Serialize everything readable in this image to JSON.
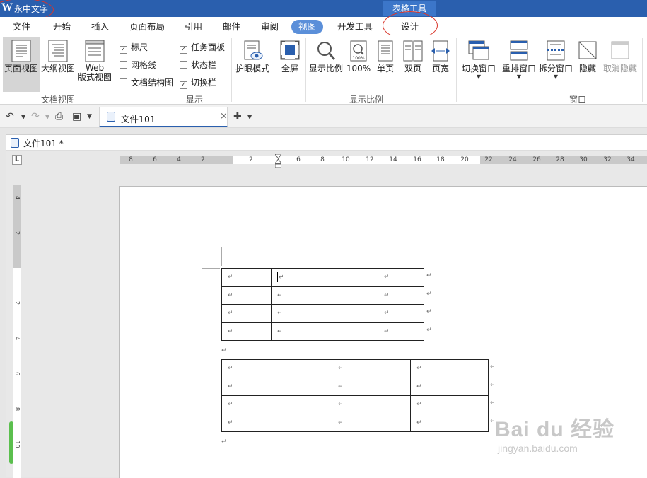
{
  "app": {
    "title": "永中文字",
    "context_tab": "表格工具"
  },
  "menu": {
    "items": [
      "文件",
      "开始",
      "插入",
      "页面布局",
      "引用",
      "邮件",
      "审阅",
      "视图",
      "开发工具",
      "设计"
    ],
    "active": "视图"
  },
  "ribbon": {
    "doc_views": {
      "group_label": "文档视图",
      "page_view": "页面视图",
      "outline_view": "大纲视图",
      "web_view_line1": "Web",
      "web_view_line2": "版式视图"
    },
    "show": {
      "group_label": "显示",
      "ruler": {
        "label": "标尺",
        "checked": true
      },
      "gridlines": {
        "label": "网格线",
        "checked": false
      },
      "doc_map": {
        "label": "文档结构图",
        "checked": false
      },
      "task_pane": {
        "label": "任务面板",
        "checked": true
      },
      "status_bar": {
        "label": "状态栏",
        "checked": false
      },
      "switch_bar": {
        "label": "切换栏",
        "checked": true
      },
      "check_mark": "✓"
    },
    "eye_mode": "护眼模式",
    "fullscreen": "全屏",
    "zoom": {
      "group_label": "显示比例",
      "zoom_ratio": "显示比例",
      "hundred": "100%",
      "hundred_icon_text": "100%",
      "single": "单页",
      "double": "双页",
      "page_width": "页宽"
    },
    "window": {
      "group_label": "窗口",
      "switch_window": "切换窗口",
      "rearrange": "重排窗口",
      "split": "拆分窗口",
      "hide": "隐藏",
      "unhide": "取消隐藏"
    }
  },
  "tabs": {
    "doc_tab": "文件101",
    "close_glyph": "×"
  },
  "document": {
    "window_title": "文件101 *",
    "ruler_corner": "L",
    "ruler_numbers": [
      "8",
      "6",
      "4",
      "2",
      "2",
      "6",
      "8",
      "10",
      "12",
      "14",
      "16",
      "18",
      "20",
      "22",
      "24",
      "26",
      "28",
      "30",
      "32",
      "34"
    ],
    "vruler_numbers": [
      "4",
      "2",
      "2",
      "4",
      "6",
      "8",
      "10"
    ],
    "cell_mark": "↵",
    "table1": {
      "rows": 4,
      "cols": 3
    },
    "table2": {
      "rows": 4,
      "cols": 3
    }
  },
  "watermark": {
    "main": "Bai du 经验",
    "sub": "jingyan.baidu.com"
  },
  "colors": {
    "title_bar": "#2a5fae",
    "active_tab": "#5b8fd9",
    "annotation": "#d9362b"
  }
}
